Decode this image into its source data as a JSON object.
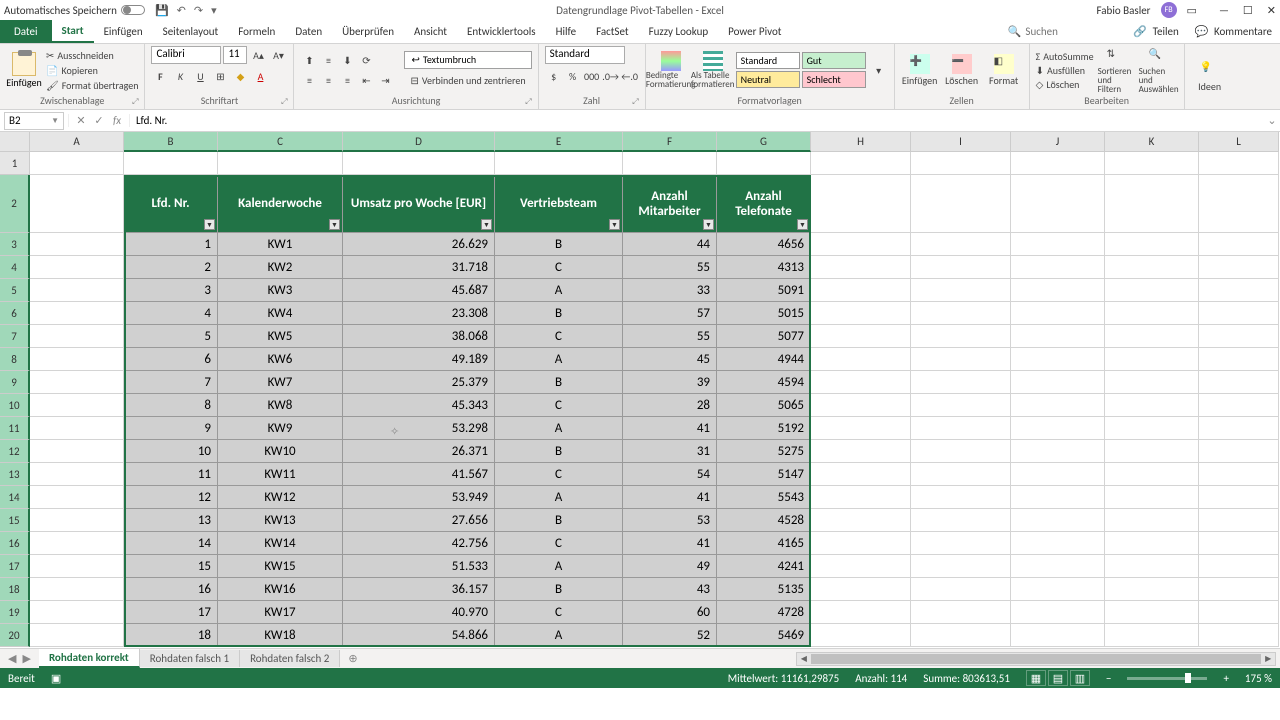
{
  "titlebar": {
    "autosave": "Automatisches Speichern",
    "doc_title": "Datengrundlage Pivot-Tabellen - Excel",
    "user": "Fabio Basler",
    "user_initials": "FB"
  },
  "ribbon_tabs": {
    "file": "Datei",
    "tabs": [
      "Start",
      "Einfügen",
      "Seitenlayout",
      "Formeln",
      "Daten",
      "Überprüfen",
      "Ansicht",
      "Entwicklertools",
      "Hilfe",
      "FactSet",
      "Fuzzy Lookup",
      "Power Pivot"
    ],
    "active": "Start",
    "search_placeholder": "Suchen",
    "share": "Teilen",
    "comments": "Kommentare"
  },
  "ribbon": {
    "clipboard": {
      "paste": "Einfügen",
      "cut": "Ausschneiden",
      "copy": "Kopieren",
      "format_painter": "Format übertragen",
      "label": "Zwischenablage"
    },
    "font": {
      "name": "Calibri",
      "size": "11",
      "label": "Schriftart"
    },
    "alignment": {
      "wrap": "Textumbruch",
      "merge": "Verbinden und zentrieren",
      "label": "Ausrichtung"
    },
    "number": {
      "format": "Standard",
      "label": "Zahl"
    },
    "styles": {
      "cond_format": "Bedingte Formatierung",
      "format_table": "Als Tabelle formatieren",
      "standard": "Standard",
      "gut": "Gut",
      "neutral": "Neutral",
      "schlecht": "Schlecht",
      "label": "Formatvorlagen"
    },
    "cells": {
      "insert": "Einfügen",
      "delete": "Löschen",
      "format": "Format",
      "label": "Zellen"
    },
    "editing": {
      "autosum": "AutoSumme",
      "fill": "Ausfüllen",
      "clear": "Löschen",
      "sort": "Sortieren und Filtern",
      "find": "Suchen und Auswählen",
      "ideas": "Ideen",
      "label": "Bearbeiten"
    }
  },
  "namebox": "B2",
  "formula": "Lfd. Nr.",
  "columns": [
    "A",
    "B",
    "C",
    "D",
    "E",
    "F",
    "G",
    "H",
    "I",
    "J",
    "K",
    "L"
  ],
  "row_numbers": [
    "1",
    "2",
    "3",
    "4",
    "5",
    "6",
    "7",
    "8",
    "9",
    "10",
    "11",
    "12",
    "13",
    "14",
    "15",
    "16",
    "17",
    "18",
    "19",
    "20"
  ],
  "table_headers": [
    "Lfd. Nr.",
    "Kalenderwoche",
    "Umsatz pro Woche [EUR]",
    "Vertriebsteam",
    "Anzahl Mitarbeiter",
    "Anzahl Telefonate"
  ],
  "chart_data": {
    "type": "table",
    "columns": [
      "Lfd. Nr.",
      "Kalenderwoche",
      "Umsatz pro Woche [EUR]",
      "Vertriebsteam",
      "Anzahl Mitarbeiter",
      "Anzahl Telefonate"
    ],
    "rows": [
      [
        1,
        "KW1",
        "26.629",
        "B",
        44,
        4656
      ],
      [
        2,
        "KW2",
        "31.718",
        "C",
        55,
        4313
      ],
      [
        3,
        "KW3",
        "45.687",
        "A",
        33,
        5091
      ],
      [
        4,
        "KW4",
        "23.308",
        "B",
        57,
        5015
      ],
      [
        5,
        "KW5",
        "38.068",
        "C",
        55,
        5077
      ],
      [
        6,
        "KW6",
        "49.189",
        "A",
        45,
        4944
      ],
      [
        7,
        "KW7",
        "25.379",
        "B",
        39,
        4594
      ],
      [
        8,
        "KW8",
        "45.343",
        "C",
        28,
        5065
      ],
      [
        9,
        "KW9",
        "53.298",
        "A",
        41,
        5192
      ],
      [
        10,
        "KW10",
        "26.371",
        "B",
        31,
        5275
      ],
      [
        11,
        "KW11",
        "41.567",
        "C",
        54,
        5147
      ],
      [
        12,
        "KW12",
        "53.949",
        "A",
        41,
        5543
      ],
      [
        13,
        "KW13",
        "27.656",
        "B",
        53,
        4528
      ],
      [
        14,
        "KW14",
        "42.756",
        "C",
        41,
        4165
      ],
      [
        15,
        "KW15",
        "51.533",
        "A",
        49,
        4241
      ],
      [
        16,
        "KW16",
        "36.157",
        "B",
        43,
        5135
      ],
      [
        17,
        "KW17",
        "40.970",
        "C",
        60,
        4728
      ],
      [
        18,
        "KW18",
        "54.866",
        "A",
        52,
        5469
      ]
    ]
  },
  "sheets": {
    "tabs": [
      "Rohdaten korrekt",
      "Rohdaten falsch 1",
      "Rohdaten falsch 2"
    ],
    "active": "Rohdaten korrekt"
  },
  "status": {
    "ready": "Bereit",
    "avg_label": "Mittelwert:",
    "avg": "11161,29875",
    "count_label": "Anzahl:",
    "count": "114",
    "sum_label": "Summe:",
    "sum": "803613,51",
    "zoom": "175 %"
  }
}
